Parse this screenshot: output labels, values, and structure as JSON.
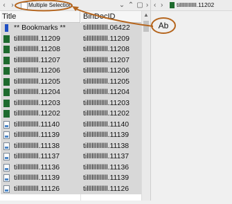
{
  "left_toolbar": {
    "nav_back": "‹",
    "nav_forward": "›",
    "title": "Multiple Selection",
    "chevron": "⌄",
    "up": "⌃",
    "maximize": "▢",
    "close": "›"
  },
  "columns": {
    "title": "Title",
    "bindocid": "BinDocID"
  },
  "rows": [
    {
      "icon": "bookmark-icon",
      "title": "** Bookmarks **",
      "bindocid": "tilllllllllllll.06422"
    },
    {
      "icon": "document-icon",
      "title": "tilllllllllllll.11209",
      "bindocid": "tilllllllllllll.11209"
    },
    {
      "icon": "document-icon",
      "title": "tilllllllllllll.11208",
      "bindocid": "tilllllllllllll.11208"
    },
    {
      "icon": "document-icon",
      "title": "tilllllllllllll.11207",
      "bindocid": "tilllllllllllll.11207"
    },
    {
      "icon": "document-icon",
      "title": "tilllllllllllll.11206",
      "bindocid": "tilllllllllllll.11206"
    },
    {
      "icon": "document-icon",
      "title": "tilllllllllllll.11205",
      "bindocid": "tilllllllllllll.11205"
    },
    {
      "icon": "document-icon",
      "title": "tilllllllllllll.11204",
      "bindocid": "tilllllllllllll.11204"
    },
    {
      "icon": "document-icon",
      "title": "tilllllllllllll.11203",
      "bindocid": "tilllllllllllll.11203"
    },
    {
      "icon": "document-icon",
      "title": "tilllllllllllll.11202",
      "bindocid": "tilllllllllllll.11202"
    },
    {
      "icon": "image-icon",
      "title": "tilllllllllllll.11140",
      "bindocid": "tilllllllllllll.11140"
    },
    {
      "icon": "image-icon",
      "title": "tilllllllllllll.11139",
      "bindocid": "tilllllllllllll.11139"
    },
    {
      "icon": "image-icon",
      "title": "tilllllllllllll.11138",
      "bindocid": "tilllllllllllll.11138"
    },
    {
      "icon": "image-icon",
      "title": "tilllllllllllll.11137",
      "bindocid": "tilllllllllllll.11137"
    },
    {
      "icon": "image-icon",
      "title": "tilllllllllllll.11136",
      "bindocid": "tilllllllllllll.11136"
    },
    {
      "icon": "image-icon",
      "title": "tilllllllllllll.11139",
      "bindocid": "tilllllllllllll.11139"
    },
    {
      "icon": "image-icon",
      "title": "tilllllllllllll.11126",
      "bindocid": "tilllllllllllll.11126"
    }
  ],
  "right_toolbar": {
    "nav_back": "‹",
    "nav_forward": "›",
    "doc_title": "tilllllllllllll.11202"
  },
  "annotation": {
    "label": "Ab",
    "color": "#b5651d"
  },
  "colors": {
    "selection": "#d8d8d8",
    "document_icon": "#1e6b2e",
    "bookmark_icon": "#1f4fc4"
  },
  "scrollbar": {
    "up_arrow": "▲"
  }
}
